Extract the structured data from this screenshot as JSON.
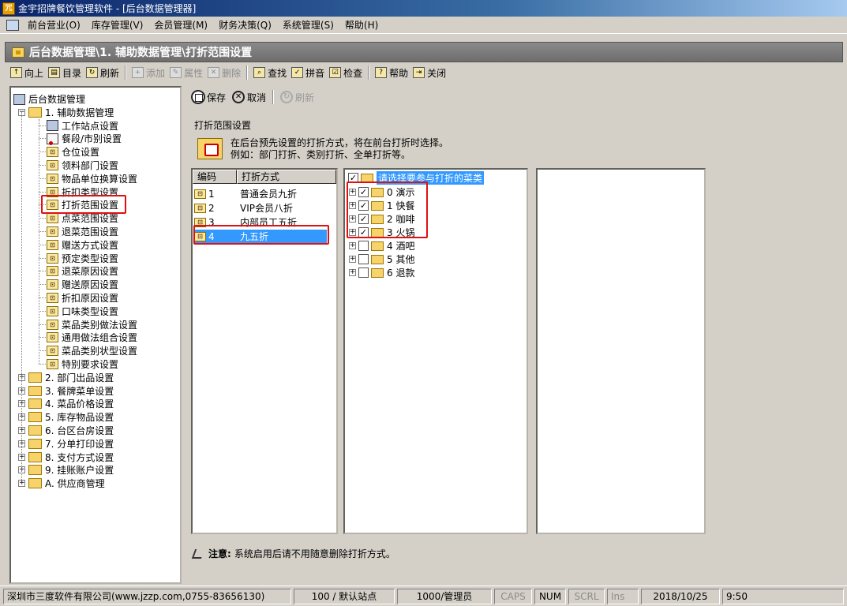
{
  "window": {
    "title": "金宇招牌餐饮管理软件 - [后台数据管理器]",
    "app_icon_text": "冗"
  },
  "menu": {
    "items": [
      "前台营业(O)",
      "库存管理(V)",
      "会员管理(M)",
      "财务决策(Q)",
      "系统管理(S)",
      "帮助(H)"
    ]
  },
  "path_title": "后台数据管理\\1. 辅助数据管理\\打折范围设置",
  "toolbar": {
    "up": "向上",
    "directory": "目录",
    "refresh": "刷新",
    "add": "添加",
    "properties": "属性",
    "delete": "删除",
    "find": "查找",
    "pinyin": "拼音",
    "check": "检查",
    "help": "帮助",
    "close": "关闭"
  },
  "tree": {
    "root": "后台数据管理",
    "group1": "1. 辅助数据管理",
    "group1_items": [
      "工作站点设置",
      "餐段/市别设置",
      "仓位设置",
      "领料部门设置",
      "物品单位换算设置",
      "折扣类型设置",
      "打折范围设置",
      "点菜范围设置",
      "退菜范围设置",
      "赠送方式设置",
      "预定类型设置",
      "退菜原因设置",
      "赠送原因设置",
      "折扣原因设置",
      "口味类型设置",
      "菜品类别做法设置",
      "通用做法组合设置",
      "菜品类别状型设置",
      "特别要求设置"
    ],
    "other_groups": [
      "2. 部门出品设置",
      "3. 餐牌菜单设置",
      "4. 菜品价格设置",
      "5. 库存物品设置",
      "6. 台区台房设置",
      "7. 分单打印设置",
      "8. 支付方式设置",
      "9. 挂账账户设置",
      "A. 供应商管理"
    ],
    "selected": "打折范围设置"
  },
  "edit_toolbar": {
    "save": "保存",
    "cancel": "取消",
    "refresh": "刷新"
  },
  "panel": {
    "title": "打折范围设置",
    "info_line1": "在后台预先设置的打折方式，将在前台打折时选择。",
    "info_line2": "例如：部门打折、类别打折、全单打折等。"
  },
  "discount_list": {
    "col_code": "编码",
    "col_method": "打折方式",
    "rows": [
      {
        "code": "1",
        "name": "普通会员九折"
      },
      {
        "code": "2",
        "name": "VIP会员八折"
      },
      {
        "code": "3",
        "name": "内部员工五折"
      },
      {
        "code": "4",
        "name": "九五折"
      }
    ],
    "selected_index": 3
  },
  "dish_tree": {
    "root_label": "请选择要参与打折的菜类",
    "root_checked": true,
    "items": [
      {
        "label": "0 演示",
        "checked": true
      },
      {
        "label": "1 快餐",
        "checked": true
      },
      {
        "label": "2 咖啡",
        "checked": true
      },
      {
        "label": "3 火锅",
        "checked": true
      },
      {
        "label": "4 酒吧",
        "checked": false
      },
      {
        "label": "5 其他",
        "checked": false
      },
      {
        "label": "6 退款",
        "checked": false
      }
    ]
  },
  "note": {
    "label": "注意:",
    "text": "系统启用后请不用随意删除打折方式。"
  },
  "statusbar": {
    "company": "深圳市三度软件有限公司(www.jzzp.com,0755-83656130)",
    "station": "100 / 默认站点",
    "operator": "1000/管理员",
    "caps": "CAPS",
    "num": "NUM",
    "scrl": "SCRL",
    "ins": "Ins",
    "date": "2018/10/25",
    "time": "9:50"
  }
}
